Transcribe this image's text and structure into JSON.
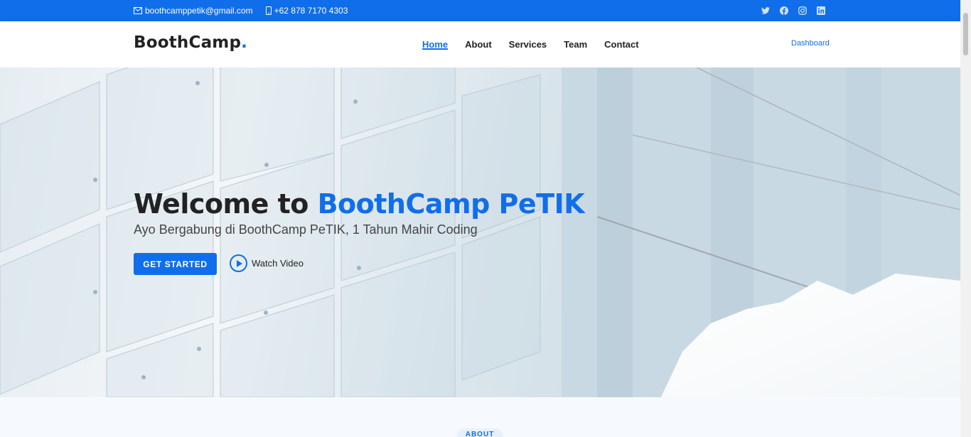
{
  "topbar": {
    "email": "boothcamppetik@gmail.com",
    "phone": "+62 878 7170 4303",
    "social_icons": [
      "twitter-icon",
      "facebook-icon",
      "instagram-icon",
      "linkedin-icon"
    ]
  },
  "header": {
    "logo_text": "BoothCamp",
    "logo_dot": ".",
    "nav": [
      "Home",
      "About",
      "Services",
      "Team",
      "Contact"
    ],
    "active_nav": "Home",
    "dashboard_link": "Dashboard"
  },
  "hero": {
    "title_prefix": "Welcome to ",
    "title_accent": "BoothCamp PeTIK",
    "subtitle": "Ayo Bergabung di BoothCamp PeTIK, 1 Tahun Mahir Coding",
    "cta_label": "GET STARTED",
    "watch_label": "Watch Video"
  },
  "about": {
    "badge": "ABOUT"
  },
  "colors": {
    "accent": "#106eea",
    "text_dark": "#222222"
  }
}
